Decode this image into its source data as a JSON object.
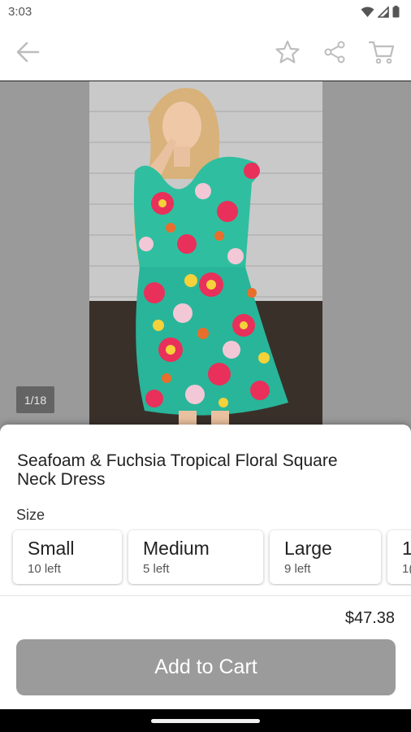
{
  "status_bar": {
    "time": "3:03",
    "icons": [
      "wifi-icon",
      "cellular-signal-icon",
      "battery-icon"
    ]
  },
  "toolbar": {
    "icons": [
      "back-arrow-icon",
      "star-icon",
      "share-icon",
      "cart-icon"
    ]
  },
  "gallery": {
    "page_indicator": "1/18"
  },
  "product": {
    "title": "Seafoam & Fuchsia Tropical Floral Square Neck Dress",
    "size_label": "Size",
    "sizes": [
      {
        "name": "Small",
        "stock": "10 left"
      },
      {
        "name": "Medium",
        "stock": "5 left"
      },
      {
        "name": "Large",
        "stock": "9 left"
      },
      {
        "name": "1",
        "stock": "1("
      }
    ],
    "price": "$47.38",
    "add_to_cart_label": "Add to Cart"
  },
  "colors": {
    "button_disabled": "#9b9b9b",
    "icon_gray": "#bdbdbd"
  }
}
